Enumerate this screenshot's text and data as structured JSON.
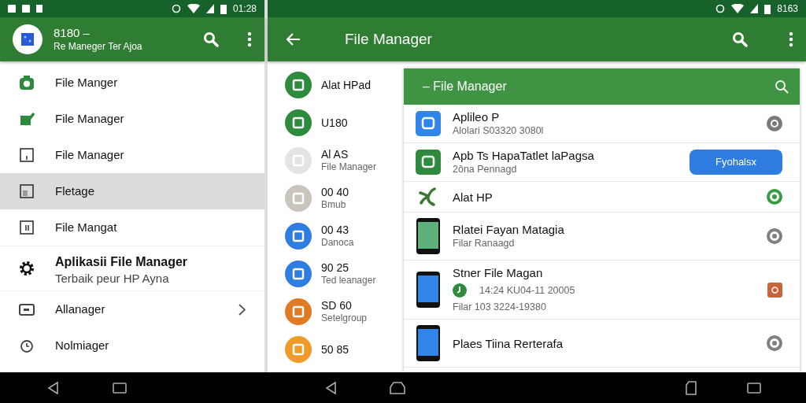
{
  "status_bars": [
    {
      "time": "01:28"
    },
    {
      "time": "8163"
    }
  ],
  "drawer": {
    "header": {
      "title": "8180 –",
      "subtitle": "Re Maneger Ter Ajoa"
    },
    "items": [
      {
        "label": "File Manger",
        "selected": false,
        "chevron": false
      },
      {
        "label": "File Manager",
        "selected": false,
        "chevron": false
      },
      {
        "label": "File Manager",
        "selected": false,
        "chevron": false
      },
      {
        "label": "Fletage",
        "selected": true,
        "chevron": false
      },
      {
        "label": "File Mangat",
        "selected": false,
        "chevron": false
      },
      {
        "label": "Aplikasii File Manager",
        "subtitle": "Terbaik peur HP Ayna",
        "selected": false,
        "chevron": false
      },
      {
        "label": "Allanager",
        "selected": false,
        "chevron": true
      },
      {
        "label": "Nolmiager",
        "selected": false,
        "chevron": false
      }
    ]
  },
  "app_bar": {
    "title": "File Manager"
  },
  "list": [
    {
      "title": "Alat HPad",
      "color": "#2e8b3e"
    },
    {
      "title": "U180",
      "color": "#2e8b3e"
    },
    {
      "title": "Al AS",
      "subtitle": "File Manager",
      "color": "#e4e4e4"
    },
    {
      "title": "00 40",
      "subtitle": "Bmub",
      "color": "#c9c5bd"
    },
    {
      "title": "00 43",
      "subtitle": "Danoca",
      "color": "#2f7de1"
    },
    {
      "title": "90 25",
      "subtitle": "Ted leanager",
      "color": "#2f7de1"
    },
    {
      "title": "SD 60",
      "subtitle": "Setelgroup",
      "color": "#e07b24"
    },
    {
      "title": "50 85",
      "color": "#f09a2a"
    }
  ],
  "card": {
    "title": "– File Manager",
    "rows": [
      {
        "icon": {
          "kind": "tile",
          "color": "#2f86e8"
        },
        "title": "Aplileo P",
        "subtitle": "Alolari S03320 3080l",
        "trailing": {
          "kind": "dot",
          "color": "#7a7a7a"
        }
      },
      {
        "icon": {
          "kind": "tile",
          "color": "#2e8b3e"
        },
        "title": "Apb Ts HapaTatlet laPagsa",
        "subtitle": "2ôna Pennagd",
        "trailing": {
          "kind": "button",
          "label": "Fyohalsx"
        }
      },
      {
        "icon": {
          "kind": "sprig",
          "color": "#3a7a30"
        },
        "title": "Alat HP",
        "trailing": {
          "kind": "ring",
          "color": "#3a9a45"
        }
      },
      {
        "icon": {
          "kind": "phone",
          "color": "#5fb07a"
        },
        "title": "Rlatei Fayan Matagia",
        "subtitle": "Filar Ranaagd",
        "trailing": {
          "kind": "ring",
          "color": "#808080"
        }
      },
      {
        "icon": {
          "kind": "phone",
          "color": "#2f86e8"
        },
        "title": "Stner File Magan",
        "meta": "14:24 KU04-11 20005",
        "subtitle": "Filar 103 3224-19380",
        "trailing": {
          "kind": "square",
          "color": "#c8663a"
        }
      },
      {
        "icon": {
          "kind": "phone",
          "color": "#2f86e8"
        },
        "title": "Plaes Tiina Rerterafa",
        "trailing": {
          "kind": "ring",
          "color": "#808080"
        }
      }
    ]
  }
}
